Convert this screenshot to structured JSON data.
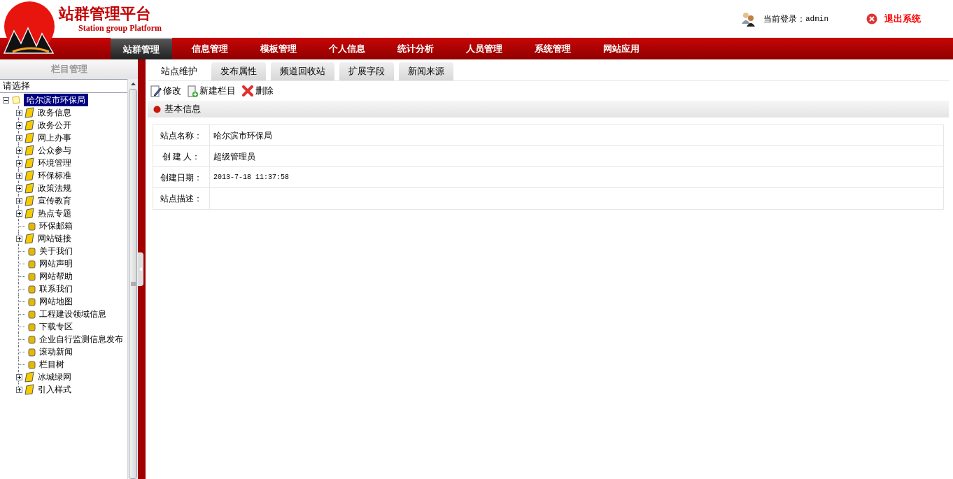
{
  "header": {
    "title": "站群管理平台",
    "subtitle": "Station group Platform",
    "login_label": "当前登录：",
    "login_user": "admin",
    "logout": "退出系统"
  },
  "nav": [
    {
      "label": "站群管理",
      "selected": true
    },
    {
      "label": "信息管理",
      "selected": false
    },
    {
      "label": "模板管理",
      "selected": false
    },
    {
      "label": "个人信息",
      "selected": false
    },
    {
      "label": "统计分析",
      "selected": false
    },
    {
      "label": "人员管理",
      "selected": false
    },
    {
      "label": "系统管理",
      "selected": false
    },
    {
      "label": "网站应用",
      "selected": false
    }
  ],
  "sidebar": {
    "title": "栏目管理",
    "select": "请选择",
    "tree": {
      "label": "哈尔滨市环保局",
      "selected": true,
      "expanded": true,
      "children": [
        {
          "label": "政务信息",
          "kind": "folder",
          "expanded": false
        },
        {
          "label": "政务公开",
          "kind": "folder",
          "expanded": false
        },
        {
          "label": "网上办事",
          "kind": "folder",
          "expanded": false
        },
        {
          "label": "公众参与",
          "kind": "folder",
          "expanded": false
        },
        {
          "label": "环境管理",
          "kind": "folder",
          "expanded": false
        },
        {
          "label": "环保标准",
          "kind": "folder",
          "expanded": false
        },
        {
          "label": "政策法规",
          "kind": "folder",
          "expanded": false
        },
        {
          "label": "宣传教育",
          "kind": "folder",
          "expanded": false
        },
        {
          "label": "热点专题",
          "kind": "folder",
          "expanded": false
        },
        {
          "label": "环保邮箱",
          "kind": "page"
        },
        {
          "label": "网站链接",
          "kind": "folder",
          "expanded": false
        },
        {
          "label": "关于我们",
          "kind": "page"
        },
        {
          "label": "网站声明",
          "kind": "page"
        },
        {
          "label": "网站帮助",
          "kind": "page"
        },
        {
          "label": "联系我们",
          "kind": "page"
        },
        {
          "label": "网站地图",
          "kind": "page"
        },
        {
          "label": "工程建设领域信息",
          "kind": "page"
        },
        {
          "label": "下载专区",
          "kind": "page"
        },
        {
          "label": "企业自行监测信息发布",
          "kind": "page"
        },
        {
          "label": "滚动新闻",
          "kind": "page"
        },
        {
          "label": "栏目树",
          "kind": "page"
        },
        {
          "label": "冰城绿网",
          "kind": "folder",
          "expanded": false
        },
        {
          "label": "引入样式",
          "kind": "folder",
          "expanded": false
        }
      ]
    }
  },
  "tabs": [
    {
      "label": "站点维护",
      "selected": true
    },
    {
      "label": "发布属性",
      "selected": false
    },
    {
      "label": "频道回收站",
      "selected": false
    },
    {
      "label": "扩展字段",
      "selected": false
    },
    {
      "label": "新闻来源",
      "selected": false
    }
  ],
  "toolbar": [
    {
      "label": "修改",
      "kind": "edit"
    },
    {
      "label": "新建栏目",
      "kind": "new"
    },
    {
      "label": "删除",
      "kind": "delete"
    }
  ],
  "section_title": "基本信息",
  "fields": [
    {
      "label": "站点名称：",
      "value": "哈尔滨市环保局"
    },
    {
      "label": "创 建 人：",
      "value": "超级管理员"
    },
    {
      "label": "创建日期：",
      "value": "2013-7-18 11:37:58",
      "kind": "mono"
    },
    {
      "label": "站点描述："
    }
  ]
}
